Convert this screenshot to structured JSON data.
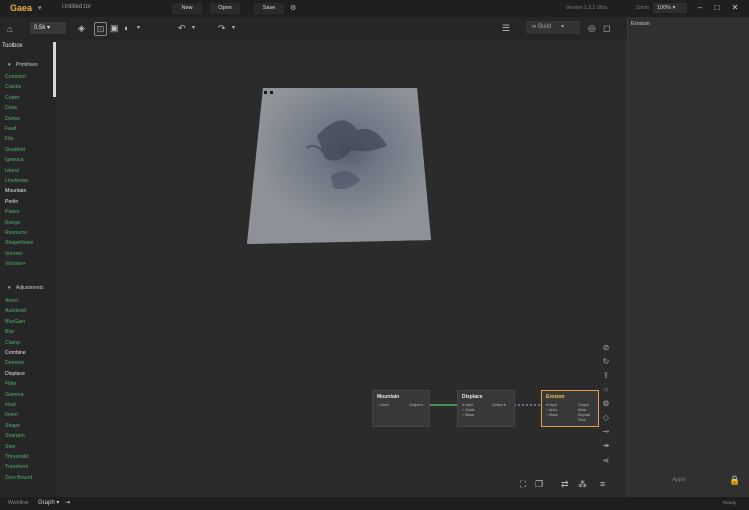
{
  "app": {
    "logo": "Gaea",
    "filename": "Untitled.tor",
    "buttons": {
      "new": "New",
      "open": "Open",
      "save": "Save"
    },
    "version": "Version 1.3.2 Ultra",
    "zoom_label": "Zoom",
    "zoom_value": "100%"
  },
  "toolbar": {
    "resolution": "0.5k",
    "build_label": "Build"
  },
  "sidebar": {
    "title": "Toolbox",
    "primitives_header": "Primitives",
    "primitives": [
      "Constant",
      "Cracks",
      "Crater",
      "Draw",
      "Dunes",
      "Fault",
      "File",
      "Gradient",
      "Igneous",
      "Island",
      "LineNoise",
      "Mountain",
      "Perlin",
      "Plates",
      "Range",
      "Resource",
      "ShapeNoise",
      "Voronoi",
      "Voronoi+"
    ],
    "adjustments_header": "Adjustments",
    "adjustments": [
      "Aniso",
      "Autolevel",
      "BlurGain",
      "Blur",
      "Clamp",
      "Combine",
      "Denoise",
      "Displace",
      "Filter",
      "Gamma",
      "Heal",
      "Invert",
      "Shape",
      "Sharpen",
      "Sine",
      "Threshold",
      "Transform",
      "Zero Bound"
    ]
  },
  "graph": {
    "nodes": {
      "mountain": {
        "title": "Mountain",
        "in": "Seed",
        "out": "Output"
      },
      "displace": {
        "title": "Displace",
        "ports": [
          "Input",
          "Guide",
          "Mask"
        ],
        "out": "Output"
      },
      "erosion": {
        "title": "Erosion",
        "ports": [
          "Input",
          "Area",
          "Mask"
        ],
        "outs": [
          "Output",
          "Wear",
          "Deposit",
          "Flow"
        ]
      }
    }
  },
  "right_panel": {
    "title": "Erosion",
    "apply": "Apply"
  },
  "statusbar": {
    "workflow": "Workflow",
    "graph": "Graph",
    "right": "Ready"
  },
  "colors": {
    "accent": "#e3b23c",
    "node_green": "#4fb36b",
    "selected_border": "#e8a04a"
  }
}
